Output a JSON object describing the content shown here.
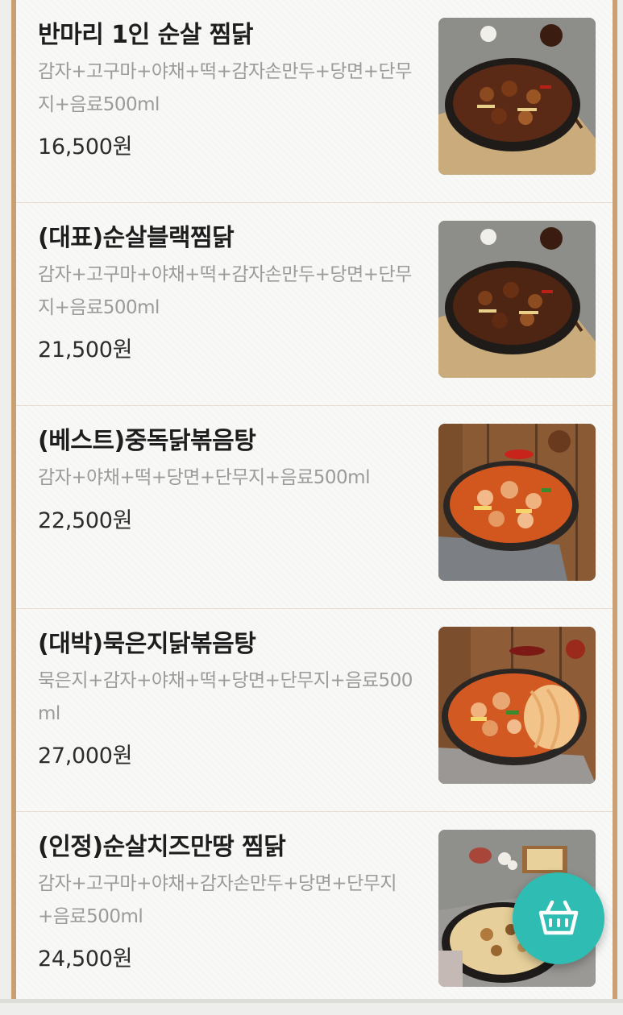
{
  "menu": {
    "items": [
      {
        "name": "반마리 1인 순살 찜닭",
        "description": "감자+고구마+야채+떡+감자손만두+당면+단무지+음료500ml",
        "price": "16,500원",
        "image_icon": "braised-chicken-photo-icon"
      },
      {
        "name": "(대표)순살블랙찜닭",
        "description": "감자+고구마+야채+떡+감자손만두+당면+단무지+음료500ml",
        "price": "21,500원",
        "image_icon": "braised-chicken-photo-icon"
      },
      {
        "name": "(베스트)중독닭볶음탕",
        "description": "감자+야채+떡+당면+단무지+음료500ml",
        "price": "22,500원",
        "image_icon": "spicy-chicken-stew-photo-icon"
      },
      {
        "name": "(대박)묵은지닭볶음탕",
        "description": "묵은지+감자+야채+떡+당면+단무지+음료500ml",
        "price": "27,000원",
        "image_icon": "kimchi-chicken-stew-photo-icon"
      },
      {
        "name": "(인정)순살치즈만땅 찜닭",
        "description": "감자+고구마+야채+감자손만두+당면+단무지+음료500ml",
        "price": "24,500원",
        "image_icon": "cheese-braised-chicken-photo-icon"
      }
    ]
  },
  "cart_button": {
    "icon": "basket-icon",
    "color": "#2fbcb2"
  },
  "colors": {
    "frame_border": "#c99f74",
    "price": "#2c2c2c",
    "description": "#9b9b9b"
  }
}
